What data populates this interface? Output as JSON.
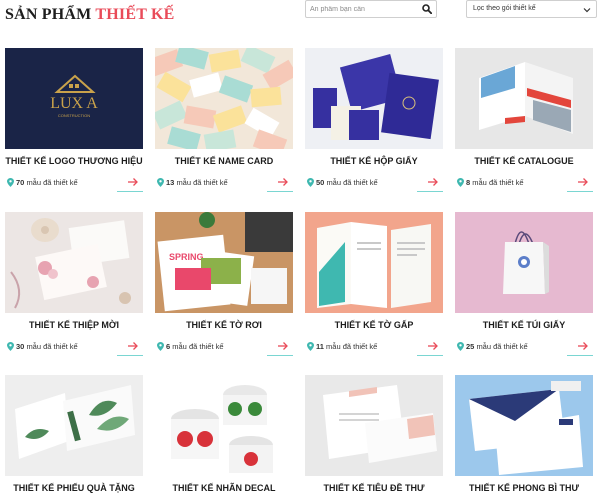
{
  "header": {
    "title_main": "SẢN PHẨM",
    "title_accent": "THIẾT KẾ",
    "search_placeholder": "Ấn phẩm bạn cần",
    "filter_value": "Lọc theo gói thiết kế"
  },
  "colors": {
    "accent": "#e94b59",
    "teal": "#3fb8b0",
    "underline": "#7ad6d2"
  },
  "count_suffix": "mẫu đã thiết kế",
  "items": [
    {
      "name": "THIẾT KẾ LOGO THƯƠNG HIỆU",
      "count": "70",
      "logo_text": "LUX A",
      "logo_sub": "CONSTRUCTION"
    },
    {
      "name": "THIẾT KẾ NAME CARD",
      "count": "13"
    },
    {
      "name": "THIẾT KẾ HỘP GIẤY",
      "count": "50"
    },
    {
      "name": "THIẾT KẾ CATALOGUE",
      "count": "8"
    },
    {
      "name": "THIẾT KẾ THIỆP MỜI",
      "count": "30"
    },
    {
      "name": "THIẾT KẾ TỜ RƠI",
      "count": "6",
      "promo_text": "SPRING"
    },
    {
      "name": "THIẾT KẾ TỜ GẤP",
      "count": "11"
    },
    {
      "name": "THIẾT KẾ TÚI GIẤY",
      "count": "25"
    },
    {
      "name": "THIẾT KẾ PHIẾU QUÀ TẶNG",
      "count": ""
    },
    {
      "name": "THIẾT KẾ NHÃN DECAL",
      "count": ""
    },
    {
      "name": "THIẾT KẾ TIÊU ĐỀ THƯ",
      "count": ""
    },
    {
      "name": "THIẾT KẾ PHONG BÌ THƯ",
      "count": ""
    }
  ]
}
